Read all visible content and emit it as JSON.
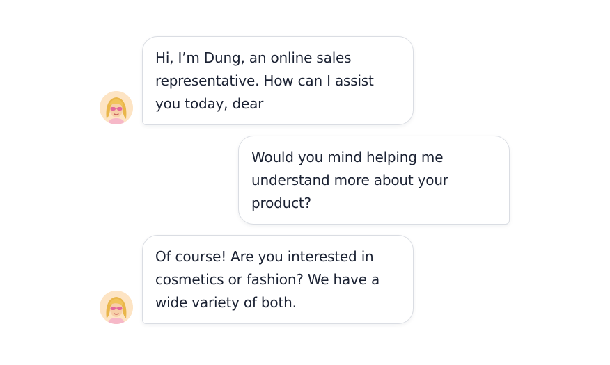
{
  "chat": {
    "messages": [
      {
        "sender": "agent",
        "text": "Hi, I’m Dung, an online sales representative. How can I assist you today, dear"
      },
      {
        "sender": "user",
        "text": "Would you mind helping me understand more about your product?"
      },
      {
        "sender": "agent",
        "text": "Of course! Are you interested in cosmetics or fashion? We have a wide variety of both."
      }
    ],
    "avatar_icon": "blonde-woman-sunglasses-avatar-icon"
  },
  "colors": {
    "background": "#ffffff",
    "bubble_border": "#dadde3",
    "text": "#1b2233",
    "avatar_bg": "#fde4c4",
    "hair": "#e9b64a",
    "glasses": "#e26a9a"
  }
}
